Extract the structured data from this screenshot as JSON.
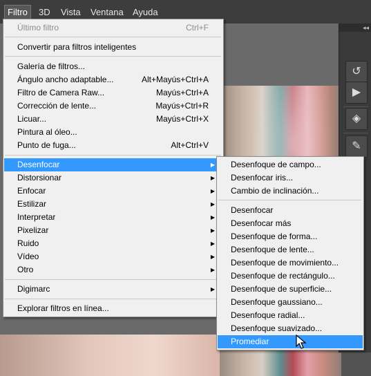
{
  "menubar": {
    "items": [
      {
        "label": "Filtro"
      },
      {
        "label": "3D"
      },
      {
        "label": "Vista"
      },
      {
        "label": "Ventana"
      },
      {
        "label": "Ayuda"
      }
    ]
  },
  "filter_menu": {
    "last_filter": {
      "label": "Último filtro",
      "shortcut": "Ctrl+F"
    },
    "convert": {
      "label": "Convertir para filtros inteligentes"
    },
    "gallery": {
      "label": "Galería de filtros..."
    },
    "adaptive_wide": {
      "label": "Ángulo ancho adaptable...",
      "shortcut": "Alt+Mayús+Ctrl+A"
    },
    "camera_raw": {
      "label": "Filtro de Camera Raw...",
      "shortcut": "Mayús+Ctrl+A"
    },
    "lens_correction": {
      "label": "Corrección de lente...",
      "shortcut": "Mayús+Ctrl+R"
    },
    "liquify": {
      "label": "Licuar...",
      "shortcut": "Mayús+Ctrl+X"
    },
    "oil_paint": {
      "label": "Pintura al óleo..."
    },
    "vanishing_point": {
      "label": "Punto de fuga...",
      "shortcut": "Alt+Ctrl+V"
    },
    "blur": {
      "label": "Desenfocar"
    },
    "distort": {
      "label": "Distorsionar"
    },
    "sharpen": {
      "label": "Enfocar"
    },
    "stylize": {
      "label": "Estilizar"
    },
    "render": {
      "label": "Interpretar"
    },
    "pixelate": {
      "label": "Pixelizar"
    },
    "noise": {
      "label": "Ruido"
    },
    "video": {
      "label": "Vídeo"
    },
    "other": {
      "label": "Otro"
    },
    "digimarc": {
      "label": "Digimarc"
    },
    "browse_online": {
      "label": "Explorar filtros en línea..."
    }
  },
  "blur_submenu": {
    "items": [
      {
        "label": "Desenfoque de campo..."
      },
      {
        "label": "Desenfocar iris..."
      },
      {
        "label": "Cambio de inclinación..."
      },
      {
        "label": "Desenfocar"
      },
      {
        "label": "Desenfocar más"
      },
      {
        "label": "Desenfoque de forma..."
      },
      {
        "label": "Desenfoque de lente..."
      },
      {
        "label": "Desenfoque de movimiento..."
      },
      {
        "label": "Desenfoque de rectángulo..."
      },
      {
        "label": "Desenfoque de superficie..."
      },
      {
        "label": "Desenfoque gaussiano..."
      },
      {
        "label": "Desenfoque radial..."
      },
      {
        "label": "Desenfoque suavizado..."
      },
      {
        "label": "Promediar"
      }
    ],
    "highlighted": "Promediar"
  },
  "tool_panel": {
    "collapse_glyph": "◂◂",
    "tools": [
      {
        "icon": "history-icon",
        "glyph": "↺"
      },
      {
        "icon": "play-action-icon",
        "glyph": "▶"
      },
      {
        "icon": "3d-cube-icon",
        "glyph": "◈"
      },
      {
        "icon": "brush-tools-icon",
        "glyph": "✎"
      }
    ]
  },
  "colors": {
    "highlight": "#3399ff",
    "menu_bg": "#f0f0f0",
    "menubar_bg": "#3d3d3d"
  }
}
